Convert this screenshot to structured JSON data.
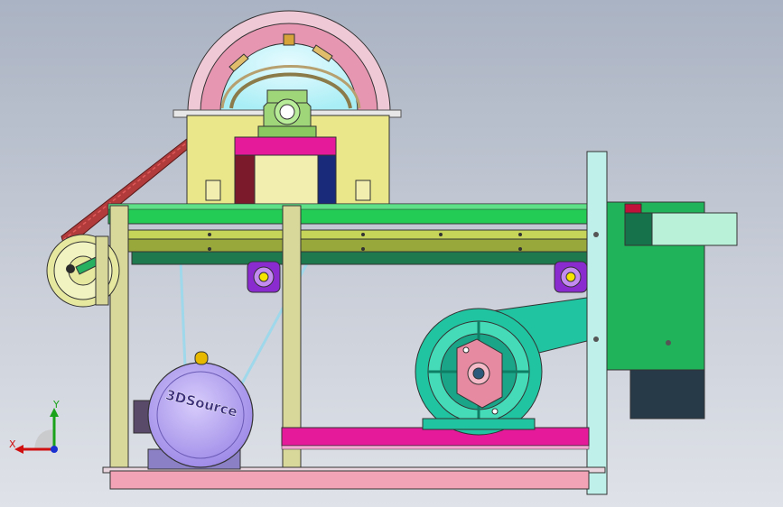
{
  "motor": {
    "label": "3DSource"
  },
  "triad": {
    "x_label": "X",
    "y_label": "Y"
  },
  "colors": {
    "background_top": "#aab3c3",
    "background_bottom": "#dfe2e8",
    "frame_green": "#22cc55",
    "hopper_yellow": "#e9e78a",
    "motor_lavender": "#b8a6f0",
    "bearing_purple": "#8a2bd0",
    "blower_teal": "#20c4a0",
    "base_pink": "#f2a3b6",
    "magenta": "#e51a9a",
    "belt_red": "#c43a3a",
    "drum_pink": "#e796b2"
  }
}
